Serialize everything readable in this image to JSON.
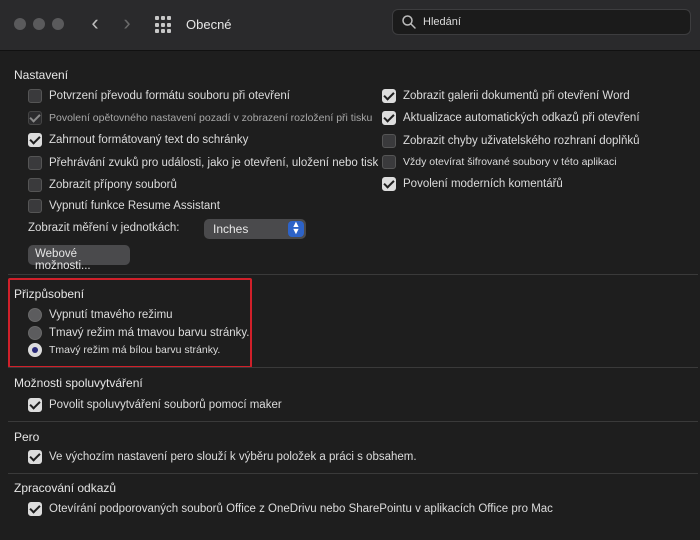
{
  "window": {
    "title": "Obecné",
    "search_placeholder": "Hledání",
    "icons": [
      "back-chevron",
      "forward-chevron",
      "grid-icon",
      "search-icon"
    ]
  },
  "nastaveni": {
    "title": "Nastavení",
    "left_items": [
      {
        "label": "Potvrzení převodu formátu souboru při otevření",
        "checked": false
      },
      {
        "label": "Povolení opětovného nastavení pozadí v zobrazení rozložení při tisku",
        "checked": true,
        "dim": true
      },
      {
        "label": "Zahrnout formátovaný text do schránky",
        "checked": true
      },
      {
        "label": "Přehrávání zvuků pro události, jako je otevření, uložení nebo tisk",
        "checked": false
      },
      {
        "label": "Zobrazit přípony souborů",
        "checked": false
      },
      {
        "label": "Vypnutí funkce Resume Assistant",
        "checked": false
      }
    ],
    "right_items": [
      {
        "label": "Zobrazit galerii dokumentů při otevření Word",
        "checked": true
      },
      {
        "label": "Aktualizace automatických odkazů při otevření",
        "checked": true
      },
      {
        "label": "Zobrazit chyby uživatelského rozhraní doplňků",
        "checked": false
      },
      {
        "label": "Vždy otevírat šifrované soubory v této aplikaci",
        "checked": false,
        "small": true
      },
      {
        "label": "Povolení moderních komentářů",
        "checked": true
      }
    ],
    "units_label": "Zobrazit měření v jednotkách:",
    "units_value": "Inches",
    "web_button": "Webové možnosti..."
  },
  "prizpusobeni": {
    "title": "Přizpůsobení",
    "options": [
      {
        "label": "Vypnutí tmavého režimu",
        "selected": false
      },
      {
        "label": "Tmavý režim má tmavou barvu stránky.",
        "selected": false
      },
      {
        "label": "Tmavý režim má bílou barvu stránky.",
        "selected": true
      }
    ],
    "highlight_color": "#d0202a"
  },
  "spoluvytvareni": {
    "title": "Možnosti spoluvytváření",
    "item": {
      "label": "Povolit spoluvytváření souborů pomocí maker",
      "checked": true
    }
  },
  "pero": {
    "title": "Pero",
    "item": {
      "label": "Ve výchozím nastavení pero slouží k výběru položek a práci s obsahem.",
      "checked": true
    }
  },
  "odkazy": {
    "title": "Zpracování odkazů",
    "item": {
      "label": "Otevírání podporovaných souborů Office z OneDrivu nebo SharePointu v aplikacích Office pro Mac",
      "checked": true
    }
  },
  "colors": {
    "background": "#1e1e1e",
    "titlebar": "#2a2a2c",
    "accent": "#2d63c8"
  }
}
